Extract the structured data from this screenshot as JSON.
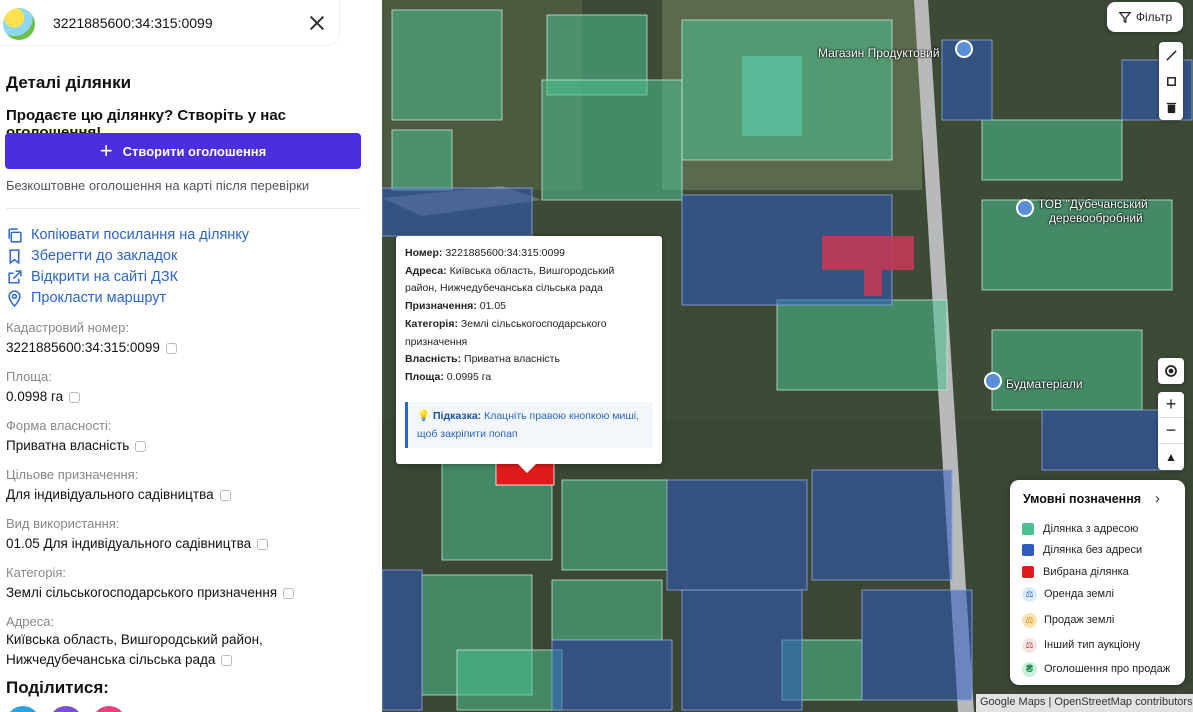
{
  "search": {
    "value": "3221885600:34:315:0099"
  },
  "details": {
    "heading": "Деталі ділянки",
    "sell_heading": "Продаєте цю ділянку? Створіть у нас оголошення!",
    "create_label": "Створити оголошення",
    "free_note": "Безкоштовне оголошення на карті після перевірки"
  },
  "actions": {
    "copy_link": "Копіювати посилання на ділянку",
    "bookmark": "Зберегти до закладок",
    "open_dzk": "Відкрити на сайті ДЗК",
    "route": "Прокласти маршрут"
  },
  "fields": {
    "cadastral_label": "Кадастровий номер:",
    "cadastral_value": "3221885600:34:315:0099",
    "area_label": "Площа:",
    "area_value": "0.0998 га",
    "ownership_label": "Форма власності:",
    "ownership_value": "Приватна власність",
    "purpose_label": "Цільове призначення:",
    "purpose_value": "Для індивідуального садівництва",
    "usage_label": "Вид використання:",
    "usage_value": "01.05 Для індивідуального садівництва",
    "category_label": "Категорія:",
    "category_value": "Землі сільськогосподарського призначення",
    "address_label": "Адреса:",
    "address_line1": "Київська область, Вишгородський район,",
    "address_line2": "Нижчедубечанська сільська рада"
  },
  "share": {
    "title": "Поділитися:"
  },
  "map": {
    "filter_label": "Фільтр",
    "poi": {
      "store": "Магазин Продуктовий",
      "tov_line1": "ТОВ \"Дубечанський",
      "tov_line2": "деревообробний",
      "bud": "Будматеріали"
    },
    "attribution": "Google Maps | OpenStreetMap contributors",
    "colors": {
      "with_address": "#4dbf8f",
      "without_address": "#2f5bbf",
      "selected": "#e01b1b"
    }
  },
  "popup": {
    "number_label": "Номер:",
    "number_value": "3221885600:34:315:0099",
    "address_label": "Адреса:",
    "address_line1": "Київська область, Вишгородський",
    "address_line2": "район, Нижчедубечанська сільська рада",
    "purpose_label": "Призначення:",
    "purpose_value": "01.05",
    "category_label": "Категорія:",
    "category_line1": "Землі сільськогосподарського",
    "category_line2": "призначення",
    "ownership_label": "Власність:",
    "ownership_value": "Приватна власність",
    "area_label": "Площа:",
    "area_value": "0.0995 га",
    "hint_label": "Підказка:",
    "hint_line1": "Клацніть правою кнопкою миші,",
    "hint_line2": "щоб закріпити попап"
  },
  "legend": {
    "title": "Умовні позначення",
    "items": [
      "Ділянка з адресою",
      "Ділянка без адреси",
      "Вибрана ділянка",
      "Оренда землі",
      "Продаж землі",
      "Інший тип аукціону",
      "Оголошення про продаж"
    ]
  }
}
